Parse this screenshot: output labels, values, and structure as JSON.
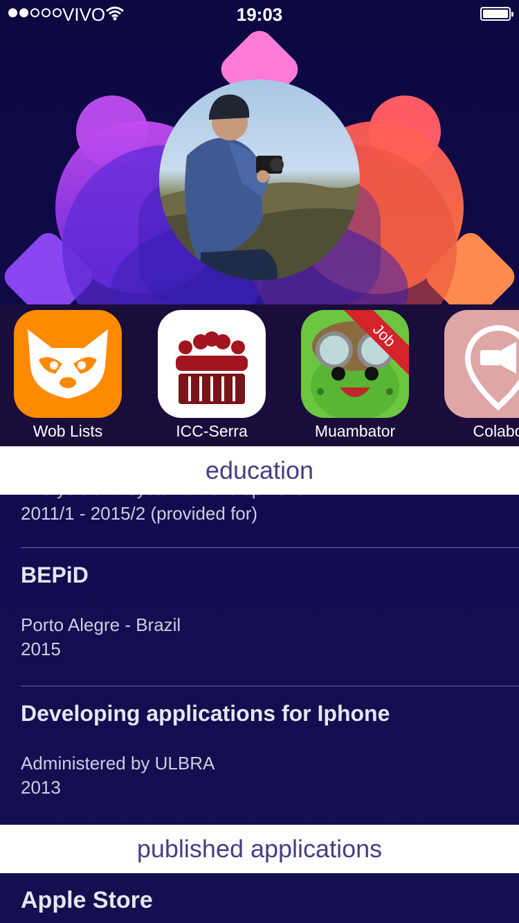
{
  "status_bar": {
    "carrier": "VIVO",
    "time": "19:03"
  },
  "apps": [
    {
      "label": "Wob Lists",
      "icon": "raccoon-icon",
      "color": "#ff8a00"
    },
    {
      "label": "ICC-Serra",
      "icon": "audience-icon",
      "color": "#ffffff"
    },
    {
      "label": "Muambator",
      "icon": "frog-aviator-icon",
      "color": "#6cc640",
      "ribbon": "Job"
    },
    {
      "label": "Colabo",
      "icon": "megaphone-pin-icon",
      "color": "#dfa6a6"
    }
  ],
  "sections": {
    "education_title": "education",
    "published_title": "published applications"
  },
  "education": {
    "partial_title": "Analysis and systems development",
    "partial_dates": "2011/1 - 2015/2 (provided for)",
    "entries": [
      {
        "title": "BEPiD",
        "location": "Porto Alegre - Brazil",
        "year": "2015"
      },
      {
        "title": "Developing applications for Iphone",
        "location": "Administered by ULBRA",
        "year": "2013"
      }
    ]
  },
  "published": {
    "first_title": "Apple Store"
  },
  "colors": {
    "background": "#0d0a44",
    "section_header_text": "#463f84",
    "app_strip": "#1a0c3b"
  }
}
